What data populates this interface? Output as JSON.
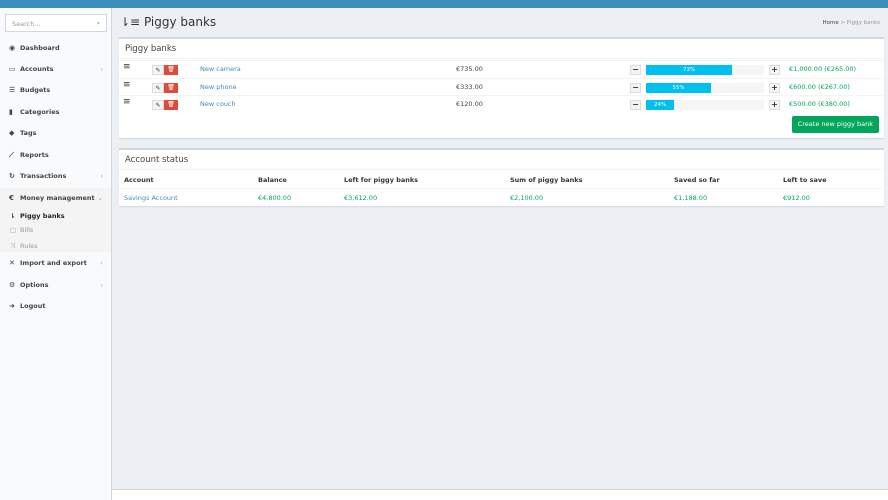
{
  "sidebar": {
    "search_placeholder": "Search...",
    "items": [
      {
        "label": "Dashboard",
        "icon": "dashboard-icon"
      },
      {
        "label": "Accounts",
        "icon": "credit-card-icon"
      },
      {
        "label": "Budgets",
        "icon": "budget-icon"
      },
      {
        "label": "Categories",
        "icon": "bar-chart-icon"
      },
      {
        "label": "Tags",
        "icon": "tag-icon"
      },
      {
        "label": "Reports",
        "icon": "line-chart-icon"
      },
      {
        "label": "Transactions",
        "icon": "repeat-icon"
      },
      {
        "label": "Money management",
        "icon": "euro-icon"
      },
      {
        "label": "Import and export",
        "icon": "arrows-icon"
      },
      {
        "label": "Options",
        "icon": "cogs-icon"
      },
      {
        "label": "Logout",
        "icon": "sign-out-icon"
      }
    ],
    "sub_items": [
      {
        "label": "Piggy banks"
      },
      {
        "label": "Bills"
      },
      {
        "label": "Rules"
      }
    ]
  },
  "header": {
    "title": "Piggy banks",
    "breadcrumb": [
      "Home",
      "Piggy banks"
    ]
  },
  "piggy_box": {
    "title": "Piggy banks",
    "create_label": "Create new piggy bank",
    "rows": [
      {
        "name": "New camera",
        "amount": "€735.00",
        "percent": 73,
        "percent_label": "73%",
        "target": "€1,000.00 (€265.00)"
      },
      {
        "name": "New phone",
        "amount": "€333.00",
        "percent": 55,
        "percent_label": "55%",
        "target": "€600.00 (€267.00)"
      },
      {
        "name": "New couch",
        "amount": "€120.00",
        "percent": 24,
        "percent_label": "24%",
        "target": "€500.00 (€380.00)"
      }
    ]
  },
  "status_box": {
    "title": "Account status",
    "headers": [
      "Account",
      "Balance",
      "Left for piggy banks",
      "Sum of piggy banks",
      "Saved so far",
      "Left to save"
    ],
    "row": [
      "Savings Account",
      "€4,800.00",
      "€3,612.00",
      "€2,100.00",
      "€1,188.00",
      "€912.00"
    ]
  },
  "colors": {
    "primary": "#3c8dbc",
    "success": "#00a65a",
    "danger": "#dd4b39",
    "progress": "#00c0ef"
  }
}
